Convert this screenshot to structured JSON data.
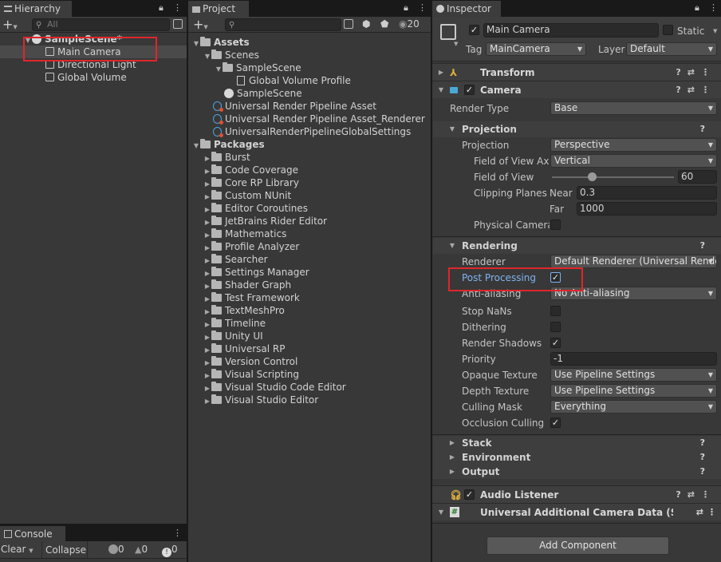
{
  "hierarchy": {
    "tab_label": "Hierarchy",
    "search_placeholder": "All",
    "scene_name": "SampleScene*",
    "items": [
      "Main Camera",
      "Directional Light",
      "Global Volume"
    ]
  },
  "project": {
    "tab_label": "Project",
    "hidden_count": "20",
    "assets_label": "Assets",
    "scenes_folder": "Scenes",
    "samplescene_folder": "SampleScene",
    "global_volume_profile": "Global Volume Profile",
    "samplescene_asset": "SampleScene",
    "urp_asset": "Universal Render Pipeline Asset",
    "urp_renderer": "Universal Render Pipeline Asset_Renderer",
    "urp_global": "UniversalRenderPipelineGlobalSettings",
    "packages_label": "Packages",
    "packages": [
      "Burst",
      "Code Coverage",
      "Core RP Library",
      "Custom NUnit",
      "Editor Coroutines",
      "JetBrains Rider Editor",
      "Mathematics",
      "Profile Analyzer",
      "Searcher",
      "Settings Manager",
      "Shader Graph",
      "Test Framework",
      "TextMeshPro",
      "Timeline",
      "Unity UI",
      "Universal RP",
      "Version Control",
      "Visual Scripting",
      "Visual Studio Code Editor",
      "Visual Studio Editor"
    ]
  },
  "console": {
    "tab_label": "Console",
    "clear_label": "Clear",
    "collapse_label": "Collapse",
    "info_count": "0",
    "warn_count": "0",
    "error_count": "0"
  },
  "inspector": {
    "tab_label": "Inspector",
    "object_name": "Main Camera",
    "static_label": "Static",
    "tag_label": "Tag",
    "tag_value": "MainCamera",
    "layer_label": "Layer",
    "layer_value": "Default",
    "transform_label": "Transform",
    "camera_label": "Camera",
    "render_type_label": "Render Type",
    "render_type_value": "Base",
    "projection_section": "Projection",
    "projection_label": "Projection",
    "projection_value": "Perspective",
    "fov_axis_label": "Field of View Axis",
    "fov_axis_value": "Vertical",
    "fov_label": "Field of View",
    "fov_value": "60",
    "clipping_label": "Clipping Planes",
    "near_label": "Near",
    "near_value": "0.3",
    "far_label": "Far",
    "far_value": "1000",
    "physical_camera_label": "Physical Camera",
    "rendering_section": "Rendering",
    "renderer_label": "Renderer",
    "renderer_value": "Default Renderer (Universal Rende",
    "post_processing_label": "Post Processing",
    "anti_aliasing_label": "Anti-aliasing",
    "anti_aliasing_value": "No Anti-aliasing",
    "stop_nans_label": "Stop NaNs",
    "dithering_label": "Dithering",
    "render_shadows_label": "Render Shadows",
    "priority_label": "Priority",
    "priority_value": "-1",
    "opaque_texture_label": "Opaque Texture",
    "opaque_texture_value": "Use Pipeline Settings",
    "depth_texture_label": "Depth Texture",
    "depth_texture_value": "Use Pipeline Settings",
    "culling_mask_label": "Culling Mask",
    "culling_mask_value": "Everything",
    "occlusion_label": "Occlusion Culling",
    "stack_label": "Stack",
    "environment_label": "Environment",
    "output_label": "Output",
    "audio_listener_label": "Audio Listener",
    "urp_camera_data_label": "Universal Additional Camera Data (Script",
    "add_component_label": "Add Component"
  },
  "colors": {
    "highlight_box": "#e0262b",
    "link_blue": "#7fb2f0",
    "panel_bg": "#383838"
  }
}
